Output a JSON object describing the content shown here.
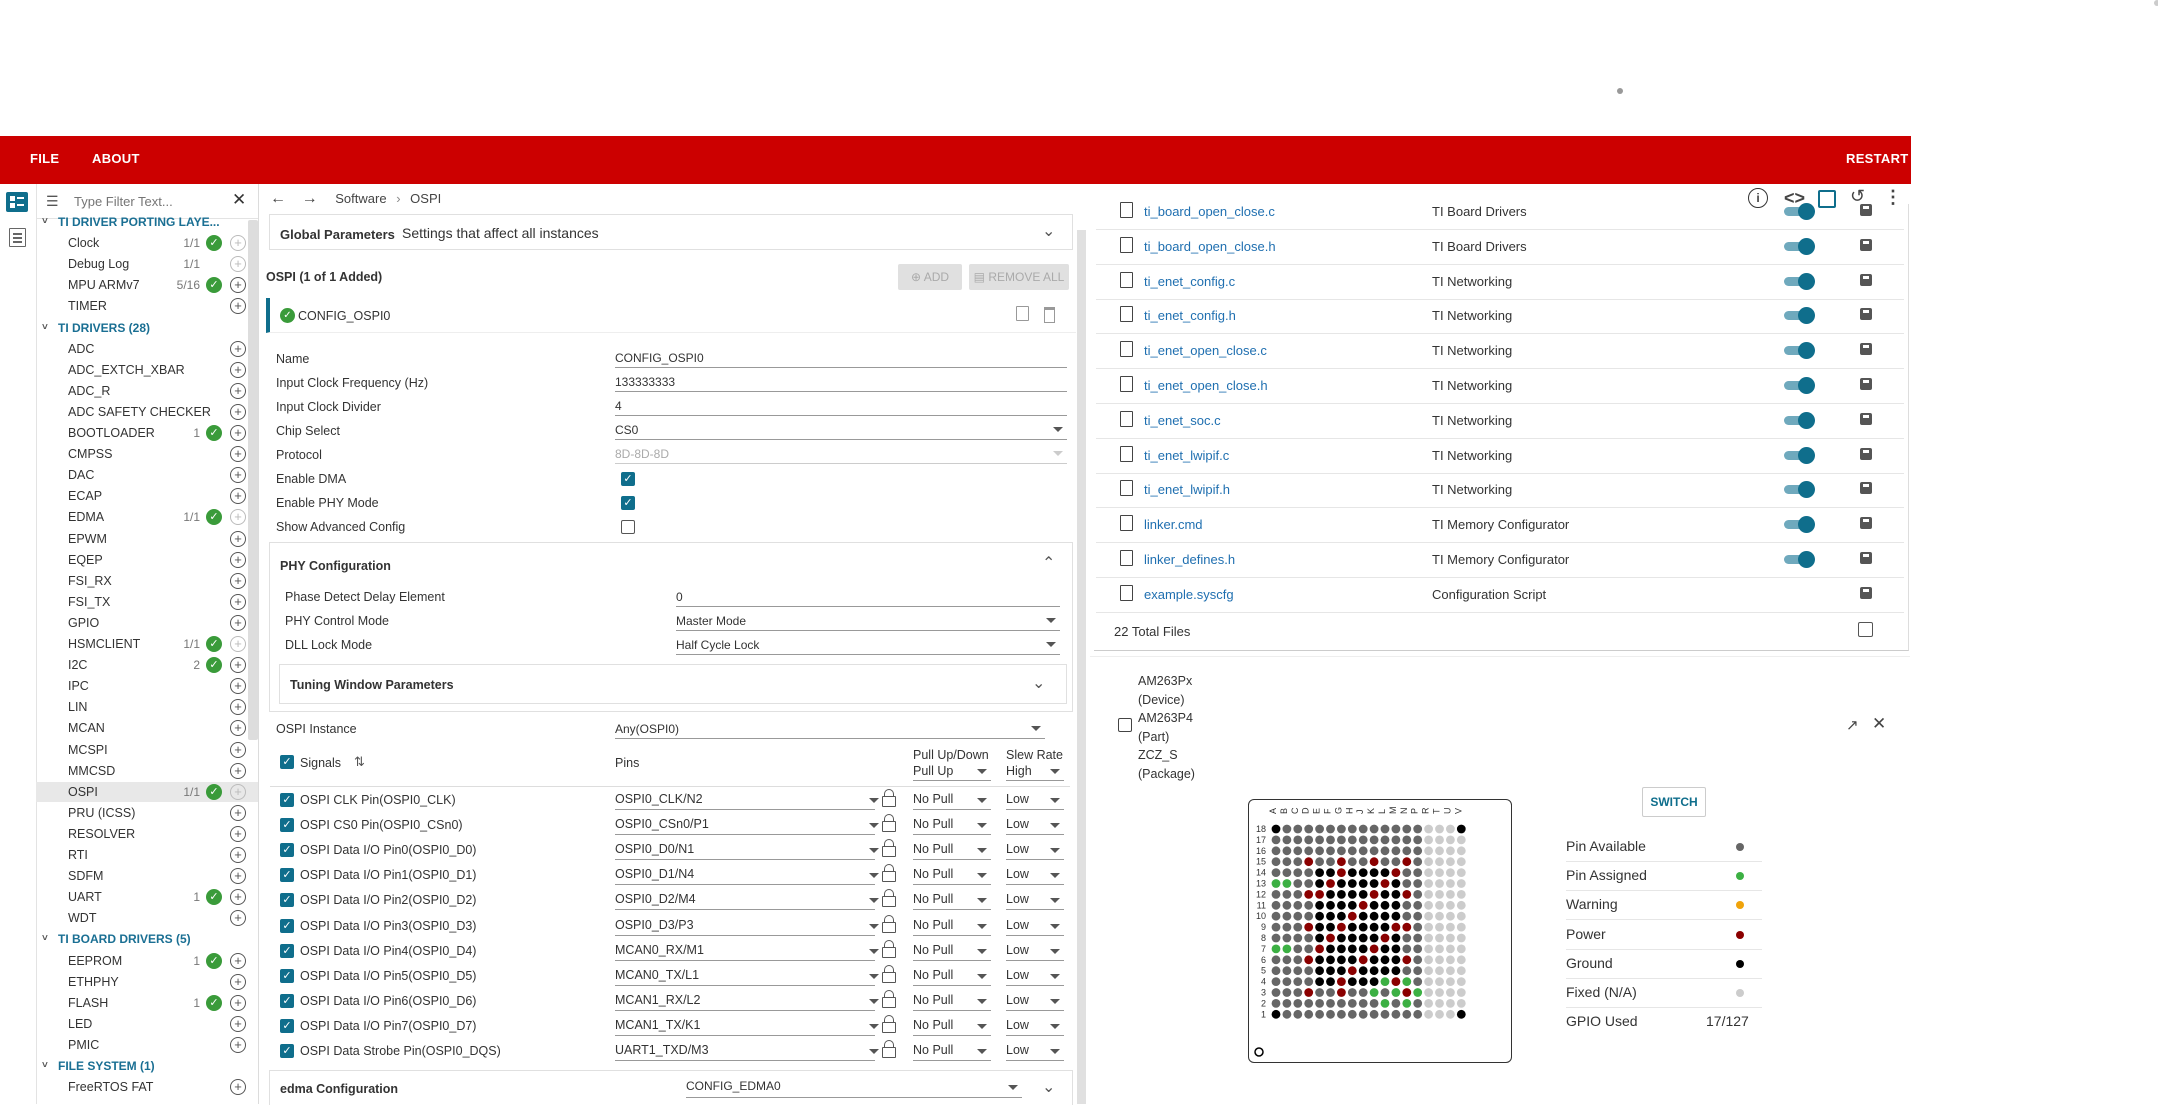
{
  "menu": {
    "file": "FILE",
    "about": "ABOUT",
    "restart": "RESTART"
  },
  "filter": {
    "placeholder": "Type Filter Text..."
  },
  "breadcrumb": {
    "root": "Software",
    "current": "OSPI"
  },
  "tree": [
    {
      "type": "group",
      "label": "TI DRIVER PORTING LAYE..."
    },
    {
      "type": "item",
      "label": "Clock",
      "count": "1/1",
      "check": true,
      "dim": true
    },
    {
      "type": "item",
      "label": "Debug Log",
      "count": "1/1",
      "check": false,
      "dim": true
    },
    {
      "type": "item",
      "label": "MPU ARMv7",
      "count": "5/16",
      "check": true,
      "dim": false
    },
    {
      "type": "item",
      "label": "TIMER",
      "count": "",
      "check": false,
      "dim": false
    },
    {
      "type": "group",
      "label": "TI DRIVERS (28)"
    },
    {
      "type": "item",
      "label": "ADC",
      "count": "",
      "check": false,
      "dim": false
    },
    {
      "type": "item",
      "label": "ADC_EXTCH_XBAR",
      "count": "",
      "check": false,
      "dim": false
    },
    {
      "type": "item",
      "label": "ADC_R",
      "count": "",
      "check": false,
      "dim": false
    },
    {
      "type": "item",
      "label": "ADC SAFETY CHECKER",
      "count": "",
      "check": false,
      "dim": false
    },
    {
      "type": "item",
      "label": "BOOTLOADER",
      "count": "1",
      "check": true,
      "dim": false
    },
    {
      "type": "item",
      "label": "CMPSS",
      "count": "",
      "check": false,
      "dim": false
    },
    {
      "type": "item",
      "label": "DAC",
      "count": "",
      "check": false,
      "dim": false
    },
    {
      "type": "item",
      "label": "ECAP",
      "count": "",
      "check": false,
      "dim": false
    },
    {
      "type": "item",
      "label": "EDMA",
      "count": "1/1",
      "check": true,
      "dim": true
    },
    {
      "type": "item",
      "label": "EPWM",
      "count": "",
      "check": false,
      "dim": false
    },
    {
      "type": "item",
      "label": "EQEP",
      "count": "",
      "check": false,
      "dim": false
    },
    {
      "type": "item",
      "label": "FSI_RX",
      "count": "",
      "check": false,
      "dim": false
    },
    {
      "type": "item",
      "label": "FSI_TX",
      "count": "",
      "check": false,
      "dim": false
    },
    {
      "type": "item",
      "label": "GPIO",
      "count": "",
      "check": false,
      "dim": false
    },
    {
      "type": "item",
      "label": "HSMCLIENT",
      "count": "1/1",
      "check": true,
      "dim": true
    },
    {
      "type": "item",
      "label": "I2C",
      "count": "2",
      "check": true,
      "dim": false
    },
    {
      "type": "item",
      "label": "IPC",
      "count": "",
      "check": false,
      "dim": false
    },
    {
      "type": "item",
      "label": "LIN",
      "count": "",
      "check": false,
      "dim": false
    },
    {
      "type": "item",
      "label": "MCAN",
      "count": "",
      "check": false,
      "dim": false
    },
    {
      "type": "item",
      "label": "MCSPI",
      "count": "",
      "check": false,
      "dim": false
    },
    {
      "type": "item",
      "label": "MMCSD",
      "count": "",
      "check": false,
      "dim": false
    },
    {
      "type": "item",
      "label": "OSPI",
      "count": "1/1",
      "check": true,
      "dim": true,
      "selected": true
    },
    {
      "type": "item",
      "label": "PRU (ICSS)",
      "count": "",
      "check": false,
      "dim": false
    },
    {
      "type": "item",
      "label": "RESOLVER",
      "count": "",
      "check": false,
      "dim": false
    },
    {
      "type": "item",
      "label": "RTI",
      "count": "",
      "check": false,
      "dim": false
    },
    {
      "type": "item",
      "label": "SDFM",
      "count": "",
      "check": false,
      "dim": false
    },
    {
      "type": "item",
      "label": "UART",
      "count": "1",
      "check": true,
      "dim": false
    },
    {
      "type": "item",
      "label": "WDT",
      "count": "",
      "check": false,
      "dim": false
    },
    {
      "type": "group",
      "label": "TI BOARD DRIVERS (5)"
    },
    {
      "type": "item",
      "label": "EEPROM",
      "count": "1",
      "check": true,
      "dim": false
    },
    {
      "type": "item",
      "label": "ETHPHY",
      "count": "",
      "check": false,
      "dim": false
    },
    {
      "type": "item",
      "label": "FLASH",
      "count": "1",
      "check": true,
      "dim": false
    },
    {
      "type": "item",
      "label": "LED",
      "count": "",
      "check": false,
      "dim": false
    },
    {
      "type": "item",
      "label": "PMIC",
      "count": "",
      "check": false,
      "dim": false
    },
    {
      "type": "group",
      "label": "FILE SYSTEM (1)"
    },
    {
      "type": "item",
      "label": "FreeRTOS FAT",
      "count": "",
      "check": false,
      "dim": false
    }
  ],
  "config": {
    "global_title": "Global Parameters",
    "global_desc": "Settings that affect all instances",
    "module_header": "OSPI (1 of 1 Added)",
    "add": "ADD",
    "remove_all": "REMOVE ALL",
    "instance_name": "CONFIG_OSPI0",
    "fields": [
      {
        "label": "Name",
        "value": "CONFIG_OSPI0",
        "kind": "text"
      },
      {
        "label": "Input Clock Frequency (Hz)",
        "value": "133333333",
        "kind": "text"
      },
      {
        "label": "Input Clock Divider",
        "value": "4",
        "kind": "text"
      },
      {
        "label": "Chip Select",
        "value": "CS0",
        "kind": "select"
      },
      {
        "label": "Protocol",
        "value": "8D-8D-8D",
        "kind": "select-disabled"
      },
      {
        "label": "Enable DMA",
        "checked": true,
        "kind": "check"
      },
      {
        "label": "Enable PHY Mode",
        "checked": true,
        "kind": "check"
      },
      {
        "label": "Show Advanced Config",
        "checked": false,
        "kind": "check"
      }
    ],
    "phy": {
      "title": "PHY Configuration",
      "fields": [
        {
          "label": "Phase Detect Delay Element",
          "value": "0",
          "kind": "text"
        },
        {
          "label": "PHY Control Mode",
          "value": "Master Mode",
          "kind": "select"
        },
        {
          "label": "DLL Lock Mode",
          "value": "Half Cycle Lock",
          "kind": "select"
        }
      ],
      "tuning": "Tuning Window Parameters"
    },
    "ospi_instance_label": "OSPI Instance",
    "ospi_instance_value": "Any(OSPI0)",
    "signals_header": {
      "signals": "Signals",
      "pins": "Pins",
      "pull": "Pull Up/Down",
      "pull_val": "Pull Up",
      "slew": "Slew Rate",
      "slew_val": "High"
    },
    "signals": [
      {
        "name": "OSPI CLK Pin(OSPI0_CLK)",
        "pin": "OSPI0_CLK/N2",
        "pull": "No Pull",
        "slew": "Low"
      },
      {
        "name": "OSPI CS0 Pin(OSPI0_CSn0)",
        "pin": "OSPI0_CSn0/P1",
        "pull": "No Pull",
        "slew": "Low"
      },
      {
        "name": "OSPI Data I/O Pin0(OSPI0_D0)",
        "pin": "OSPI0_D0/N1",
        "pull": "No Pull",
        "slew": "Low"
      },
      {
        "name": "OSPI Data I/O Pin1(OSPI0_D1)",
        "pin": "OSPI0_D1/N4",
        "pull": "No Pull",
        "slew": "Low"
      },
      {
        "name": "OSPI Data I/O Pin2(OSPI0_D2)",
        "pin": "OSPI0_D2/M4",
        "pull": "No Pull",
        "slew": "Low"
      },
      {
        "name": "OSPI Data I/O Pin3(OSPI0_D3)",
        "pin": "OSPI0_D3/P3",
        "pull": "No Pull",
        "slew": "Low"
      },
      {
        "name": "OSPI Data I/O Pin4(OSPI0_D4)",
        "pin": "MCAN0_RX/M1",
        "pull": "No Pull",
        "slew": "Low"
      },
      {
        "name": "OSPI Data I/O Pin5(OSPI0_D5)",
        "pin": "MCAN0_TX/L1",
        "pull": "No Pull",
        "slew": "Low"
      },
      {
        "name": "OSPI Data I/O Pin6(OSPI0_D6)",
        "pin": "MCAN1_RX/L2",
        "pull": "No Pull",
        "slew": "Low"
      },
      {
        "name": "OSPI Data I/O Pin7(OSPI0_D7)",
        "pin": "MCAN1_TX/K1",
        "pull": "No Pull",
        "slew": "Low"
      },
      {
        "name": "OSPI Data Strobe Pin(OSPI0_DQS)",
        "pin": "UART1_TXD/M3",
        "pull": "No Pull",
        "slew": "Low"
      }
    ],
    "edma_label": "edma Configuration",
    "edma_value": "CONFIG_EDMA0"
  },
  "files": [
    {
      "name": "ti_board_open_close.c",
      "cat": "TI Board Drivers",
      "toggle": true
    },
    {
      "name": "ti_board_open_close.h",
      "cat": "TI Board Drivers",
      "toggle": true
    },
    {
      "name": "ti_enet_config.c",
      "cat": "TI Networking",
      "toggle": true
    },
    {
      "name": "ti_enet_config.h",
      "cat": "TI Networking",
      "toggle": true
    },
    {
      "name": "ti_enet_open_close.c",
      "cat": "TI Networking",
      "toggle": true
    },
    {
      "name": "ti_enet_open_close.h",
      "cat": "TI Networking",
      "toggle": true
    },
    {
      "name": "ti_enet_soc.c",
      "cat": "TI Networking",
      "toggle": true
    },
    {
      "name": "ti_enet_lwipif.c",
      "cat": "TI Networking",
      "toggle": true
    },
    {
      "name": "ti_enet_lwipif.h",
      "cat": "TI Networking",
      "toggle": true
    },
    {
      "name": "linker.cmd",
      "cat": "TI Memory Configurator",
      "toggle": true
    },
    {
      "name": "linker_defines.h",
      "cat": "TI Memory Configurator",
      "toggle": true
    },
    {
      "name": "example.syscfg",
      "cat": "Configuration Script",
      "toggle": false
    }
  ],
  "files_total": "22 Total Files",
  "device": {
    "device": "AM263Px",
    "device_t": "(Device)",
    "part": "AM263P4",
    "part_t": "(Part)",
    "pkg": "ZCZ_S",
    "pkg_t": "(Package)",
    "switch": "SWITCH"
  },
  "pinmap": {
    "cols": [
      "A",
      "B",
      "C",
      "D",
      "E",
      "F",
      "G",
      "H",
      "J",
      "K",
      "L",
      "M",
      "N",
      "P",
      "R",
      "T",
      "U",
      "V"
    ],
    "rows": [
      "18",
      "17",
      "16",
      "15",
      "14",
      "13",
      "12",
      "11",
      "10",
      "9",
      "8",
      "7",
      "6",
      "5",
      "4",
      "3",
      "2",
      "1"
    ]
  },
  "legend": [
    {
      "label": "Pin Available",
      "color": "#666666"
    },
    {
      "label": "Pin Assigned",
      "color": "#3cb043"
    },
    {
      "label": "Warning",
      "color": "#f0a30a"
    },
    {
      "label": "Power",
      "color": "#8b0000"
    },
    {
      "label": "Ground",
      "color": "#000000"
    },
    {
      "label": "Fixed (N/A)",
      "color": "#cccccc"
    }
  ],
  "gpio_used": {
    "label": "GPIO Used",
    "value": "17/127"
  }
}
